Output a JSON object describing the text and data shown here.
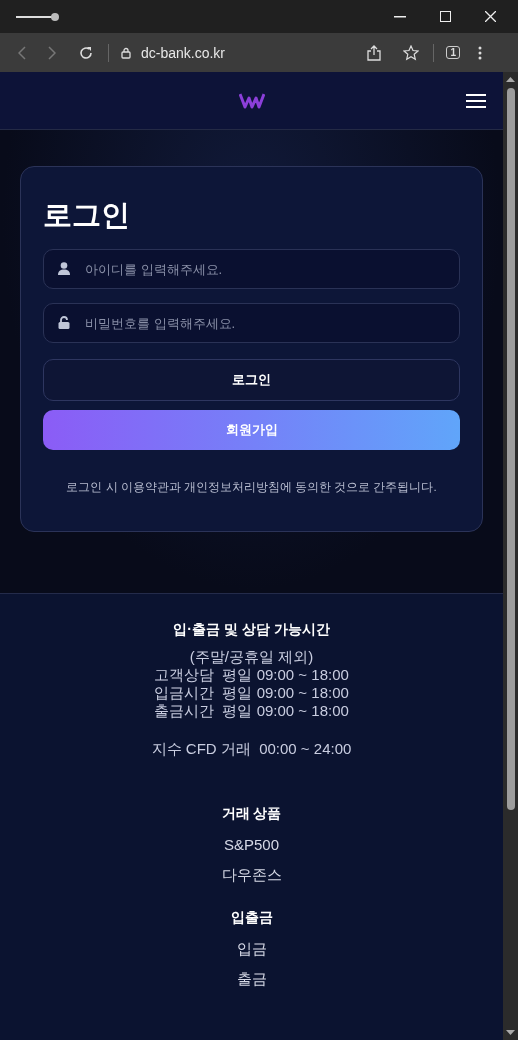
{
  "browser": {
    "url": "dc-bank.co.kr",
    "tab_count": "1"
  },
  "login": {
    "title": "로그인",
    "fields": [
      {
        "kind": "user",
        "placeholder": "아이디를 입력해주세요."
      },
      {
        "kind": "password",
        "placeholder": "비밀번호를 입력해주세요."
      }
    ],
    "buttons": [
      {
        "kind": "outline",
        "label": "로그인"
      },
      {
        "kind": "gradient",
        "label": "회원가입"
      }
    ],
    "notice": "로그인 시 이용약관과 개인정보처리방침에 동의한 것으로 간주됩니다."
  },
  "footer": {
    "hours": {
      "title": "입·출금 및 상담 가능시간",
      "lines": [
        "(주말/공휴일 제외)",
        "고객상담  평일 09:00 ~ 18:00",
        "입금시간  평일 09:00 ~ 18:00",
        "출금시간  평일 09:00 ~ 18:00"
      ],
      "extra": "지수 CFD 거래  00:00 ~ 24:00"
    },
    "sections": [
      {
        "title": "거래 상품",
        "links": [
          "S&P500",
          "다우존스"
        ]
      },
      {
        "title": "입출금",
        "links": [
          "입금",
          "출금"
        ]
      }
    ]
  }
}
